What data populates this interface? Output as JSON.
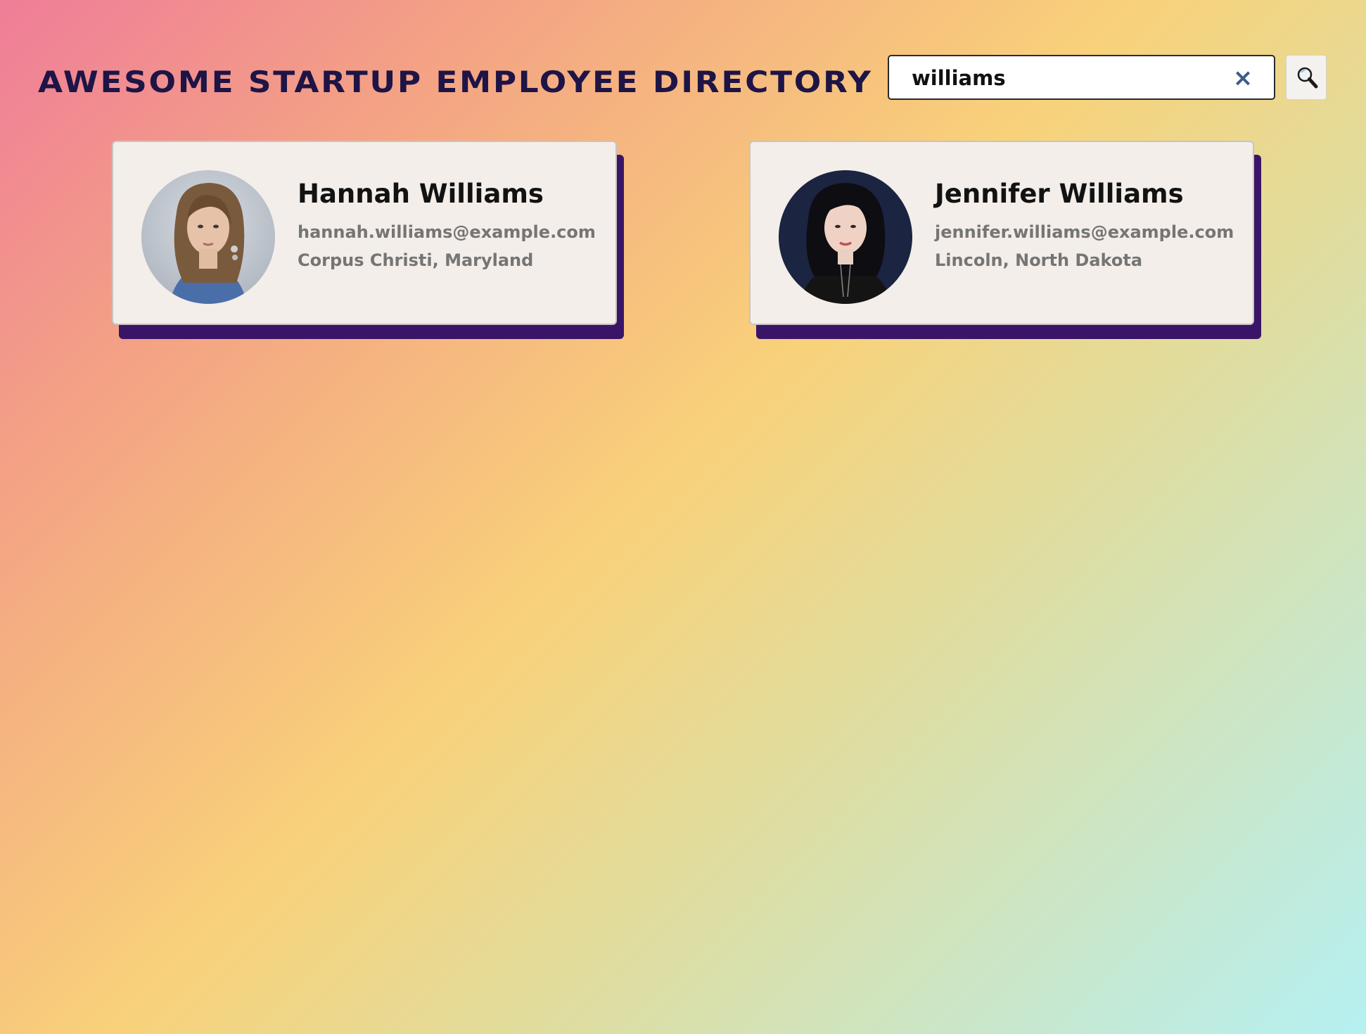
{
  "header": {
    "title": "Awesome Startup Employee Directory",
    "search": {
      "value": "williams",
      "clear_icon": "×",
      "button_icon": "search-icon"
    }
  },
  "results": [
    {
      "name": "Hannah Williams",
      "email": "hannah.williams@example.com",
      "location": "Corpus Christi, Maryland",
      "avatar": "portrait-photo-woman-wavy-hair"
    },
    {
      "name": "Jennifer Williams",
      "email": "jennifer.williams@example.com",
      "location": "Lincoln, North Dakota",
      "avatar": "portrait-photo-woman-dark-hair"
    }
  ],
  "colors": {
    "title": "#1e1446",
    "card_shadow": "#3a1567",
    "card_background": "#f3eeea",
    "clear_icon": "#3d5a8a",
    "secondary_text": "#757575"
  }
}
